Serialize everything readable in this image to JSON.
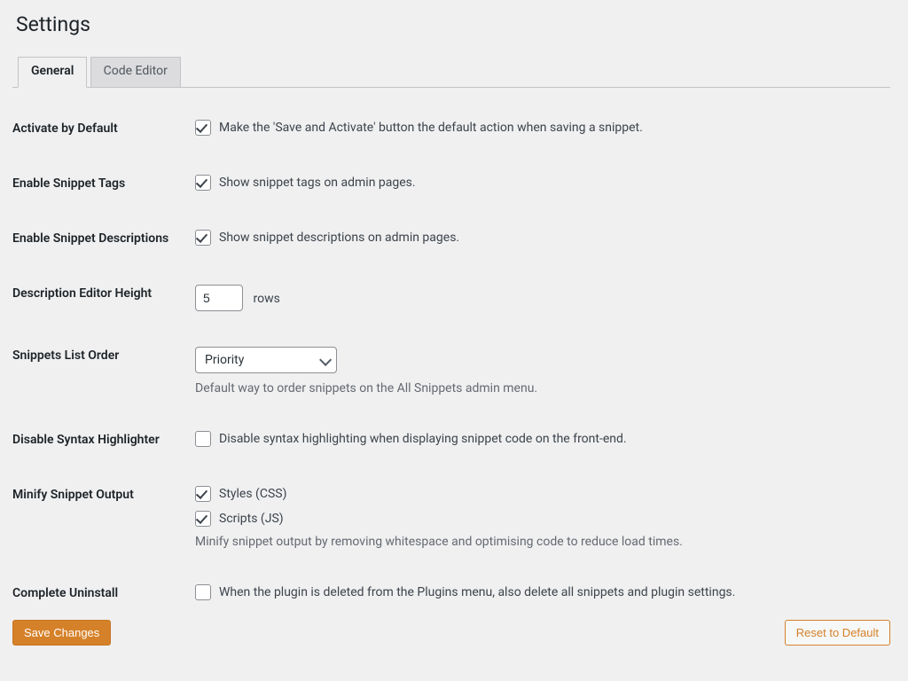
{
  "page_title": "Settings",
  "tabs": [
    {
      "label": "General",
      "active": true
    },
    {
      "label": "Code Editor",
      "active": false
    }
  ],
  "settings": {
    "activate_default": {
      "label": "Activate by Default",
      "checked": true,
      "text": "Make the 'Save and Activate' button the default action when saving a snippet."
    },
    "enable_tags": {
      "label": "Enable Snippet Tags",
      "checked": true,
      "text": "Show snippet tags on admin pages."
    },
    "enable_descriptions": {
      "label": "Enable Snippet Descriptions",
      "checked": true,
      "text": "Show snippet descriptions on admin pages."
    },
    "editor_height": {
      "label": "Description Editor Height",
      "value": "5",
      "suffix": "rows"
    },
    "list_order": {
      "label": "Snippets List Order",
      "value": "Priority",
      "description": "Default way to order snippets on the All Snippets admin menu."
    },
    "disable_syntax": {
      "label": "Disable Syntax Highlighter",
      "checked": false,
      "text": "Disable syntax highlighting when displaying snippet code on the front-end."
    },
    "minify": {
      "label": "Minify Snippet Output",
      "css": {
        "checked": true,
        "text": "Styles (CSS)"
      },
      "js": {
        "checked": true,
        "text": "Scripts (JS)"
      },
      "description": "Minify snippet output by removing whitespace and optimising code to reduce load times."
    },
    "uninstall": {
      "label": "Complete Uninstall",
      "checked": false,
      "text": "When the plugin is deleted from the Plugins menu, also delete all snippets and plugin settings."
    }
  },
  "buttons": {
    "save": "Save Changes",
    "reset": "Reset to Default"
  }
}
